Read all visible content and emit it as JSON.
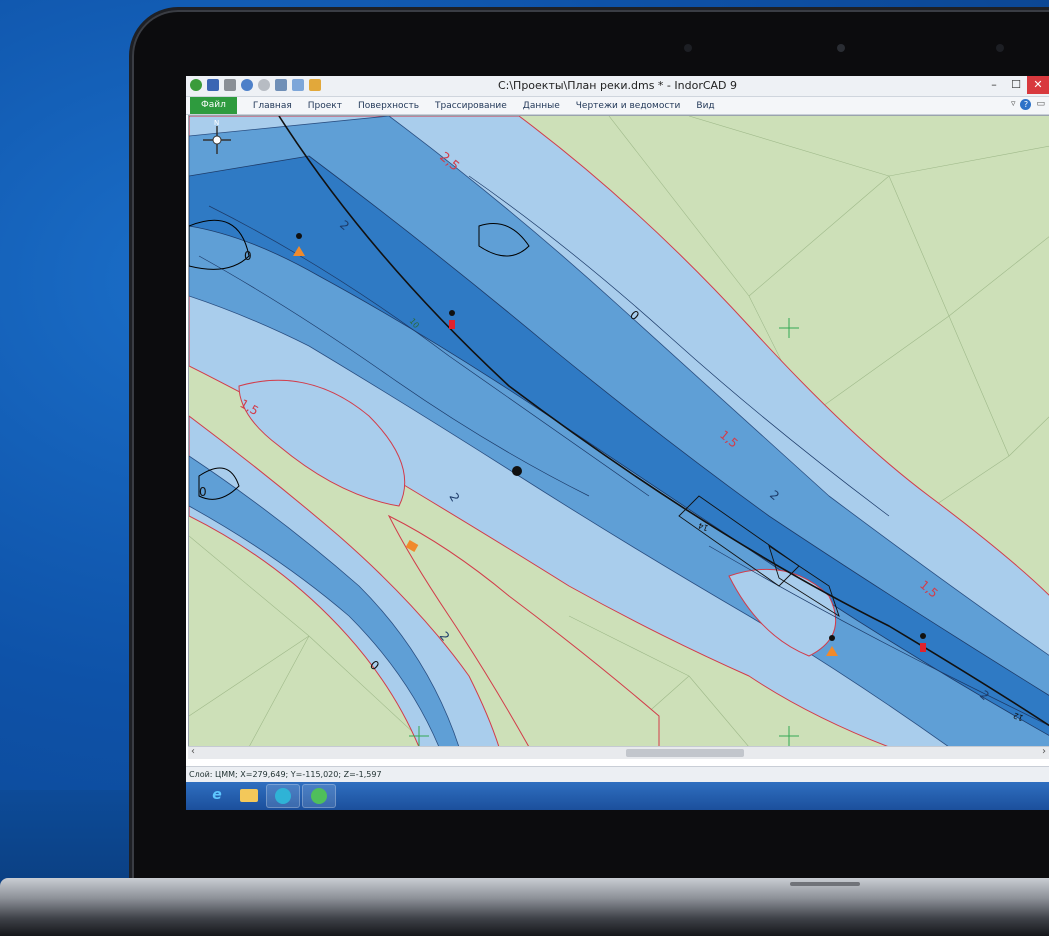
{
  "window": {
    "title": "C:\\Проекты\\План реки.dms * - IndorCAD 9"
  },
  "ribbon": {
    "file_tab": "Файл",
    "tabs": [
      "Главная",
      "Проект",
      "Поверхность",
      "Трассирование",
      "Данные",
      "Чертежи и ведомости",
      "Вид"
    ]
  },
  "map": {
    "compass_label": "N",
    "depth_labels": {
      "m0": "0",
      "m15": "1,5",
      "m2": "2",
      "m25": "2,5",
      "m14": "14",
      "m12": "12",
      "m10": "10"
    },
    "colors": {
      "land": "#cde0b8",
      "shallow": "#a9cdec",
      "mid": "#5f9fd6",
      "deep": "#2f7ac4",
      "isobath_red": "#d23c4a",
      "isobath_dark": "#1d3b69"
    }
  },
  "status": {
    "text": "Слой: ЦММ; X=279,649; Y=-115,020; Z=-1,597"
  },
  "taskbar": {
    "icons": [
      "internet-explorer-icon",
      "folder-icon",
      "indorcad-icon",
      "indorgis-icon"
    ]
  }
}
